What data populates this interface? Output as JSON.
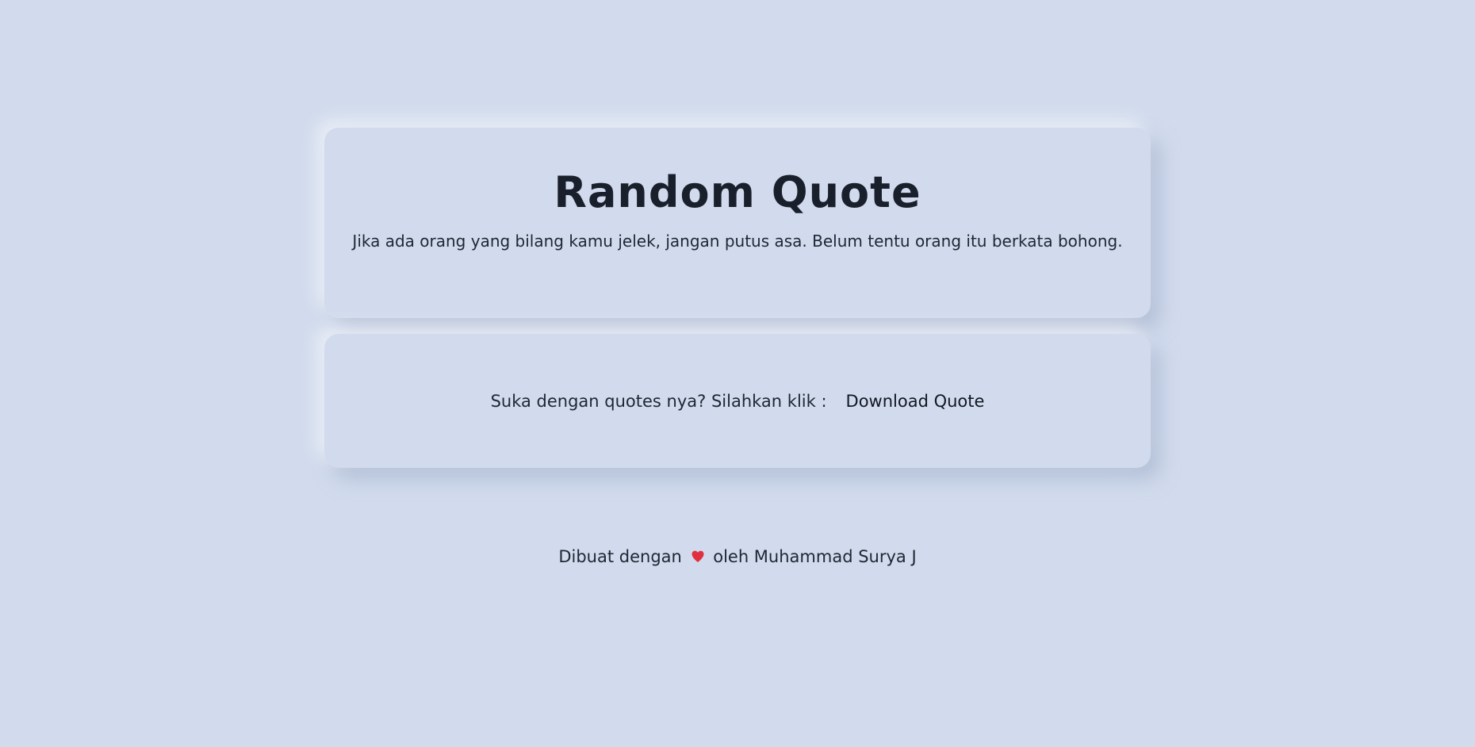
{
  "page": {
    "background": "#d1dbed",
    "accent": "#e0303f"
  },
  "quote_card": {
    "title": "Random Quote",
    "quote": "Jika ada orang yang bilang kamu jelek, jangan putus asa. Belum tentu orang itu berkata bohong."
  },
  "download_card": {
    "prompt": "Suka dengan quotes nya? Silahkan klik :",
    "button_label": "Download Quote"
  },
  "footer": {
    "prefix": "Dibuat dengan",
    "icon": "heart-icon",
    "suffix": "oleh Muhammad Surya J"
  }
}
